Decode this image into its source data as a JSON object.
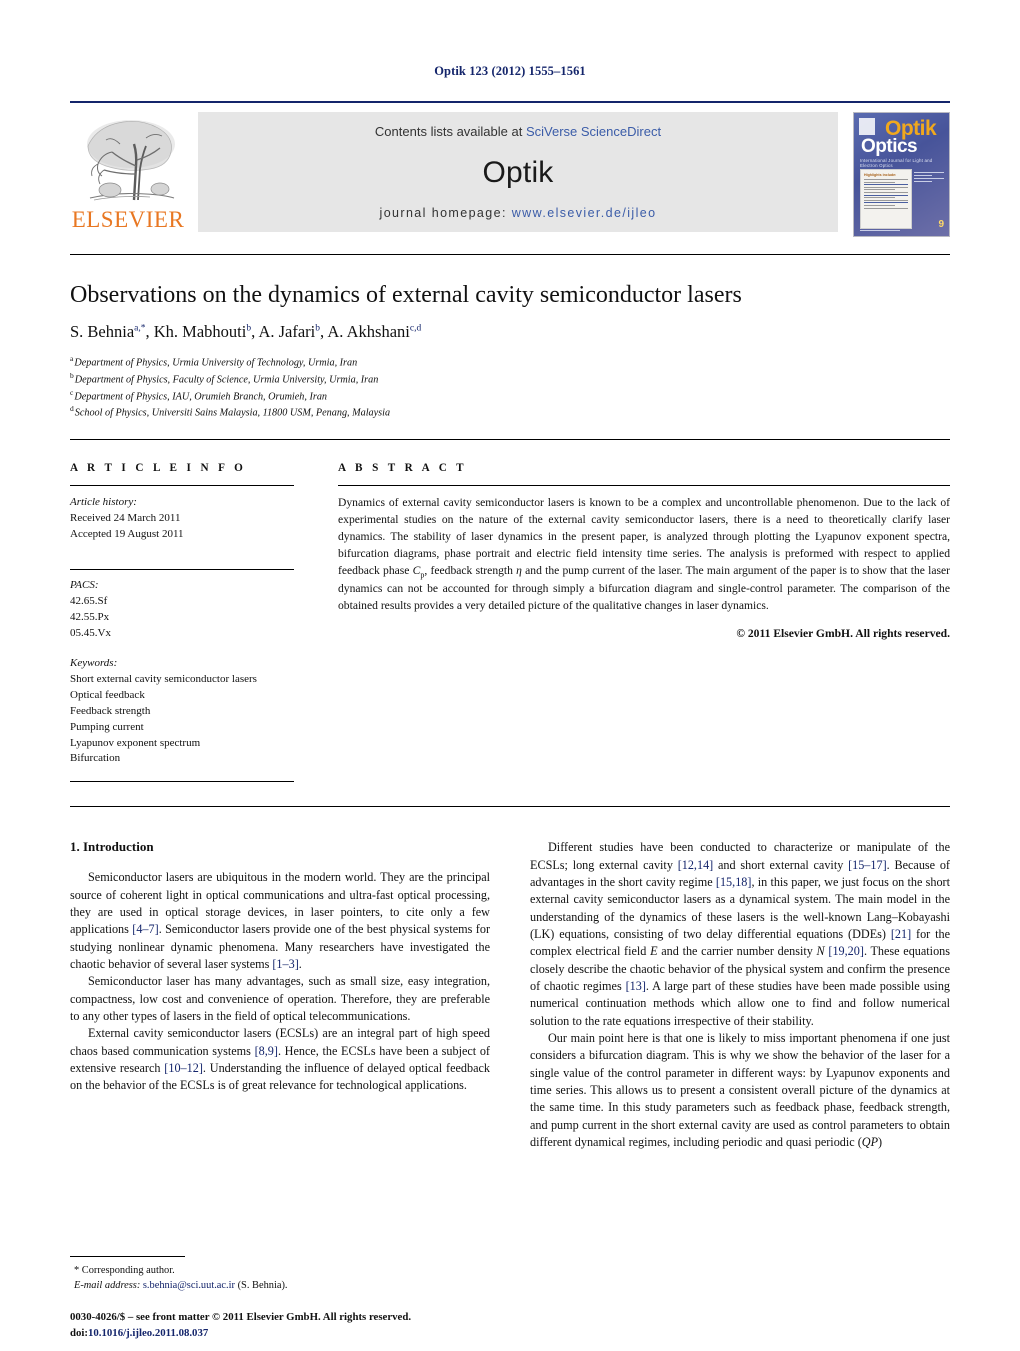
{
  "running_head": "Optik 123 (2012) 1555–1561",
  "banner": {
    "publisher_name": "ELSEVIER",
    "contents_prefix": "Contents lists available at ",
    "contents_link": "SciVerse ScienceDirect",
    "journal_name": "Optik",
    "homepage_prefix": "journal homepage: ",
    "homepage_url": "www.elsevier.de/ijleo",
    "cover": {
      "title_main": "Optik",
      "title_sub": "Optics",
      "tagline": "International Journal for Light and Electron Optics",
      "box_title": "Highlights include:",
      "issue_number": "9",
      "issue_meta": "Volume 123\n2012"
    }
  },
  "article": {
    "title": "Observations on the dynamics of external cavity semiconductor lasers",
    "authors_plain": "S. Behnia a,*, Kh. Mabhouti b, A. Jafari b, A. Akhshani c,d",
    "authors": [
      {
        "name": "S. Behnia",
        "sup": "a,*"
      },
      {
        "name": "Kh. Mabhouti",
        "sup": "b"
      },
      {
        "name": "A. Jafari",
        "sup": "b"
      },
      {
        "name": "A. Akhshani",
        "sup": "c,d"
      }
    ],
    "affiliations": [
      {
        "mark": "a",
        "text": "Department of Physics, Urmia University of Technology, Urmia, Iran"
      },
      {
        "mark": "b",
        "text": "Department of Physics, Faculty of Science, Urmia University, Urmia, Iran"
      },
      {
        "mark": "c",
        "text": "Department of Physics, IAU, Orumieh Branch, Orumieh, Iran"
      },
      {
        "mark": "d",
        "text": "School of Physics, Universiti Sains Malaysia, 11800 USM, Penang, Malaysia"
      }
    ]
  },
  "article_info": {
    "heading": "A R T I C L E    I N F O",
    "history_label": "Article history:",
    "received": "Received 24 March 2011",
    "accepted": "Accepted 19 August 2011",
    "pacs_label": "PACS:",
    "pacs": [
      "42.65.Sf",
      "42.55.Px",
      "05.45.Vx"
    ],
    "keywords_label": "Keywords:",
    "keywords": [
      "Short external cavity semiconductor lasers",
      "Optical feedback",
      "Feedback strength",
      "Pumping current",
      "Lyapunov exponent spectrum",
      "Bifurcation"
    ]
  },
  "abstract": {
    "heading": "A B S T R A C T",
    "text_part1": "Dynamics of external cavity semiconductor lasers is known to be a complex and uncontrollable phenomenon. Due to the lack of experimental studies on the nature of the external cavity semiconductor lasers, there is a need to theoretically clarify laser dynamics. The stability of laser dynamics in the present paper, is analyzed through plotting the Lyapunov exponent spectra, bifurcation diagrams, phase portrait and electric field intensity time series. The analysis is preformed with respect to applied feedback phase ",
    "text_cp": "C",
    "text_cp_sub": "p",
    "text_part2": ", feedback strength ",
    "text_eta": "η",
    "text_part3": " and the pump current of the laser. The main argument of the paper is to show that the laser dynamics can not be accounted for through simply a bifurcation diagram and single-control parameter. The comparison of the obtained results provides a very detailed picture of the qualitative changes in laser dynamics.",
    "copyright": "© 2011 Elsevier GmbH. All rights reserved."
  },
  "body": {
    "section_title": "1.  Introduction",
    "left_paragraphs": [
      {
        "segments": [
          {
            "t": "Semiconductor lasers are ubiquitous in the modern world. They are the principal source of coherent light in optical communications and ultra-fast optical processing, they are used in optical storage devices, in laser pointers, to cite only a few applications "
          },
          {
            "t": "[4–7]",
            "ref": true
          },
          {
            "t": ". Semiconductor lasers provide one of the best physical systems for studying nonlinear dynamic phenomena. Many researchers have investigated the chaotic behavior of several laser systems "
          },
          {
            "t": "[1–3]",
            "ref": true
          },
          {
            "t": "."
          }
        ]
      },
      {
        "segments": [
          {
            "t": "Semiconductor laser has many advantages, such as small size, easy integration, compactness, low cost and convenience of operation. Therefore, they are preferable to any other types of lasers in the field of optical telecommunications."
          }
        ]
      },
      {
        "segments": [
          {
            "t": "External cavity semiconductor lasers (ECSLs) are an integral part of high speed chaos based communication systems "
          },
          {
            "t": "[8,9]",
            "ref": true
          },
          {
            "t": ". Hence, the ECSLs have been a subject of extensive research "
          },
          {
            "t": "[10–12]",
            "ref": true
          },
          {
            "t": ". Understanding the influence of delayed optical feedback on the behavior of the ECSLs is of great relevance for technological applications."
          }
        ]
      }
    ],
    "right_paragraphs": [
      {
        "segments": [
          {
            "t": "Different studies have been conducted to characterize or manipulate of the ECSLs; long external cavity "
          },
          {
            "t": "[12,14]",
            "ref": true
          },
          {
            "t": " and short external cavity "
          },
          {
            "t": "[15–17]",
            "ref": true
          },
          {
            "t": ". Because of advantages in the short cavity regime "
          },
          {
            "t": "[15,18]",
            "ref": true
          },
          {
            "t": ", in this paper, we just focus on the short external cavity semiconductor lasers as a dynamical system. The main model in the understanding of the dynamics of these lasers is the well-known Lang–Kobayashi (LK) equations, consisting of two delay differential equations (DDEs) "
          },
          {
            "t": "[21]",
            "ref": true
          },
          {
            "t": " for the complex electrical field "
          },
          {
            "t": "E",
            "italic": true
          },
          {
            "t": " and the carrier number density "
          },
          {
            "t": "N",
            "italic": true
          },
          {
            "t": " "
          },
          {
            "t": "[19,20]",
            "ref": true
          },
          {
            "t": ". These equations closely describe the chaotic behavior of the physical system and confirm the presence of chaotic regimes "
          },
          {
            "t": "[13]",
            "ref": true
          },
          {
            "t": ". A large part of these studies have been made possible using numerical continuation methods which allow one to find and follow numerical solution to the rate equations irrespective of their stability."
          }
        ]
      },
      {
        "segments": [
          {
            "t": "Our main point here is that one is likely to miss important phenomena if one just considers a bifurcation diagram. This is why we show the behavior of the laser for a single value of the control parameter in different ways: by Lyapunov exponents and time series. This allows us to present a consistent overall picture of the dynamics at the same time. In this study parameters such as feedback phase, feedback strength, and pump current in the short external cavity are used as control parameters to obtain different dynamical regimes, including periodic and quasi periodic ("
          },
          {
            "t": "QP",
            "italic": true
          },
          {
            "t": ")"
          }
        ]
      }
    ]
  },
  "footer": {
    "corresponding_author": "* Corresponding author.",
    "email_label": "E-mail address:",
    "email": "s.behnia@sci.uut.ac.ir",
    "email_owner": "(S. Behnia).",
    "imprint": "0030-4026/$ – see front matter © 2011 Elsevier GmbH. All rights reserved.",
    "doi_label": "doi:",
    "doi": "10.1016/j.ijleo.2011.08.037"
  },
  "colors": {
    "heading_blue": "#14256b",
    "link_blue": "#3b5ca8",
    "elsevier_orange": "#e87722",
    "banner_gray": "#e6e6e6"
  }
}
